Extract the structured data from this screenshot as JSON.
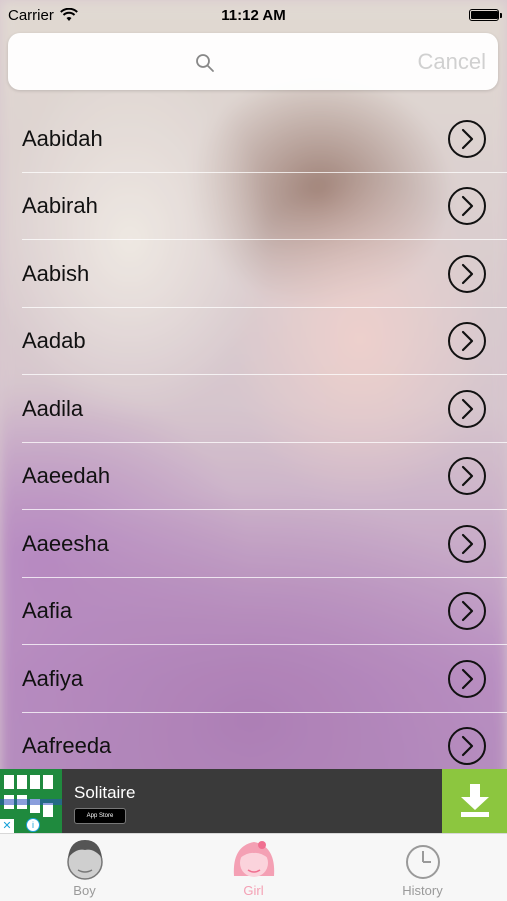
{
  "status_bar": {
    "carrier": "Carrier",
    "time": "11:12 AM",
    "battery_level": 0.95
  },
  "search": {
    "placeholder": "",
    "cancel_label": "Cancel"
  },
  "names": [
    "Aabidah",
    "Aabirah",
    "Aabish",
    "Aadab",
    "Aadila",
    "Aaeedah",
    "Aaeesha",
    "Aafia",
    "Aafiya",
    "Aafreeda"
  ],
  "ad": {
    "title": "Solitaire",
    "badge": "App Store",
    "close": "✕",
    "info": "i"
  },
  "tabs": [
    {
      "label": "Boy",
      "icon": "boy-face-icon"
    },
    {
      "label": "Girl",
      "icon": "girl-face-icon"
    },
    {
      "label": "History",
      "icon": "clock-icon"
    }
  ],
  "colors": {
    "accent_active_tab": "#f4a0b4",
    "download_green": "#8cc63f",
    "ad_background": "#3a3a3a"
  }
}
